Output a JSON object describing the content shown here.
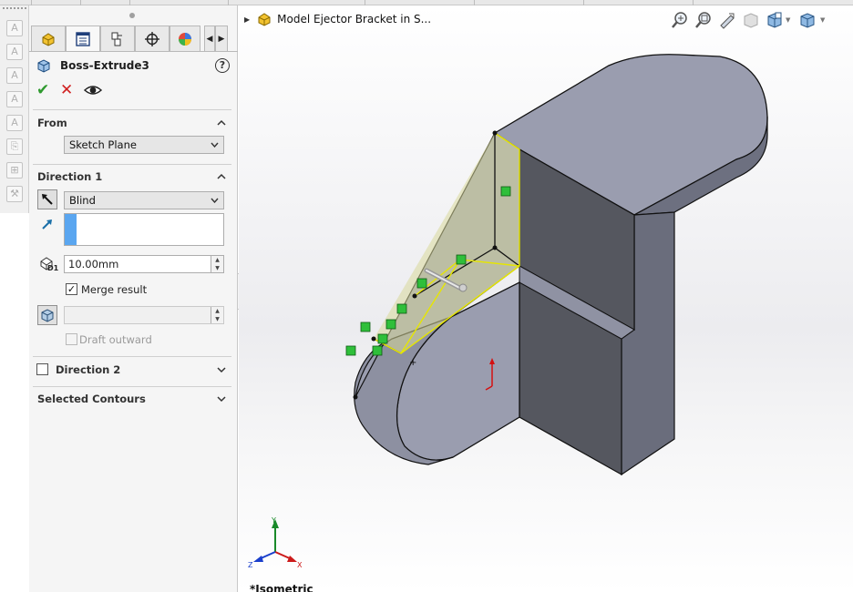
{
  "property_manager": {
    "title": "Boss-Extrude3",
    "help_glyph": "?",
    "tabs": [
      "feature-manager",
      "property-manager",
      "configuration-manager",
      "dimxpert-manager",
      "display-manager"
    ],
    "from": {
      "title": "From",
      "selected": "Sketch Plane"
    },
    "direction1": {
      "title": "Direction 1",
      "end_condition": "Blind",
      "direction_reference": "",
      "depth": "10.00mm",
      "depth_label": "D1",
      "merge_result_label": "Merge result",
      "merge_result_checked": true,
      "draft_value": "",
      "draft_outward_label": "Draft outward",
      "draft_outward_checked": false
    },
    "direction2": {
      "title": "Direction 2",
      "checked": false
    },
    "selected_contours": {
      "title": "Selected Contours"
    }
  },
  "viewport": {
    "part_name": "Model Ejector Bracket in S...",
    "view_name": "*Isometric",
    "triad_labels": {
      "x": "X",
      "y": "Y",
      "z": "Z"
    }
  },
  "colors": {
    "model_face_light": "#9a9daf",
    "model_face_mid": "#7c7f92",
    "model_face_dark": "#55575f",
    "sketch_yellow": "#e6e600",
    "relation_green": "#2fbf3a",
    "accent_blue": "#5aa6f0"
  }
}
